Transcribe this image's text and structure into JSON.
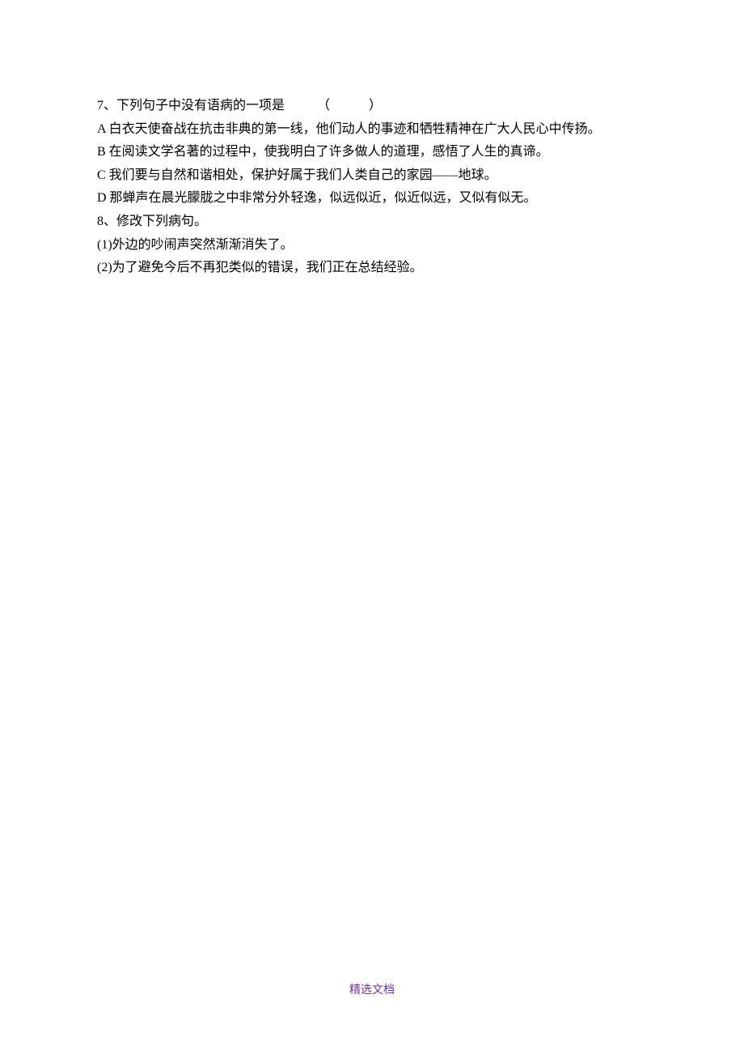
{
  "q7": {
    "stem": "7、下列句子中没有语病的一项是　　　（　　　）",
    "optionA": "A 白衣天使奋战在抗击非典的第一线，他们动人的事迹和牺牲精神在广大人民心中传扬。",
    "optionB": "B 在阅读文学名著的过程中，使我明白了许多做人的道理，感悟了人生的真谛。",
    "optionC": "C 我们要与自然和谐相处，保护好属于我们人类自己的家园——地球。",
    "optionD": "D 那蝉声在晨光朦胧之中非常分外轻逸，似远似近，似近似远，又似有似无。"
  },
  "q8": {
    "stem": "8、修改下列病句。",
    "item1": "(1)外边的吵闹声突然渐渐消失了。",
    "item2": "(2)为了避免今后不再犯类似的错误，我们正在总结经验。"
  },
  "footer": "精选文档"
}
